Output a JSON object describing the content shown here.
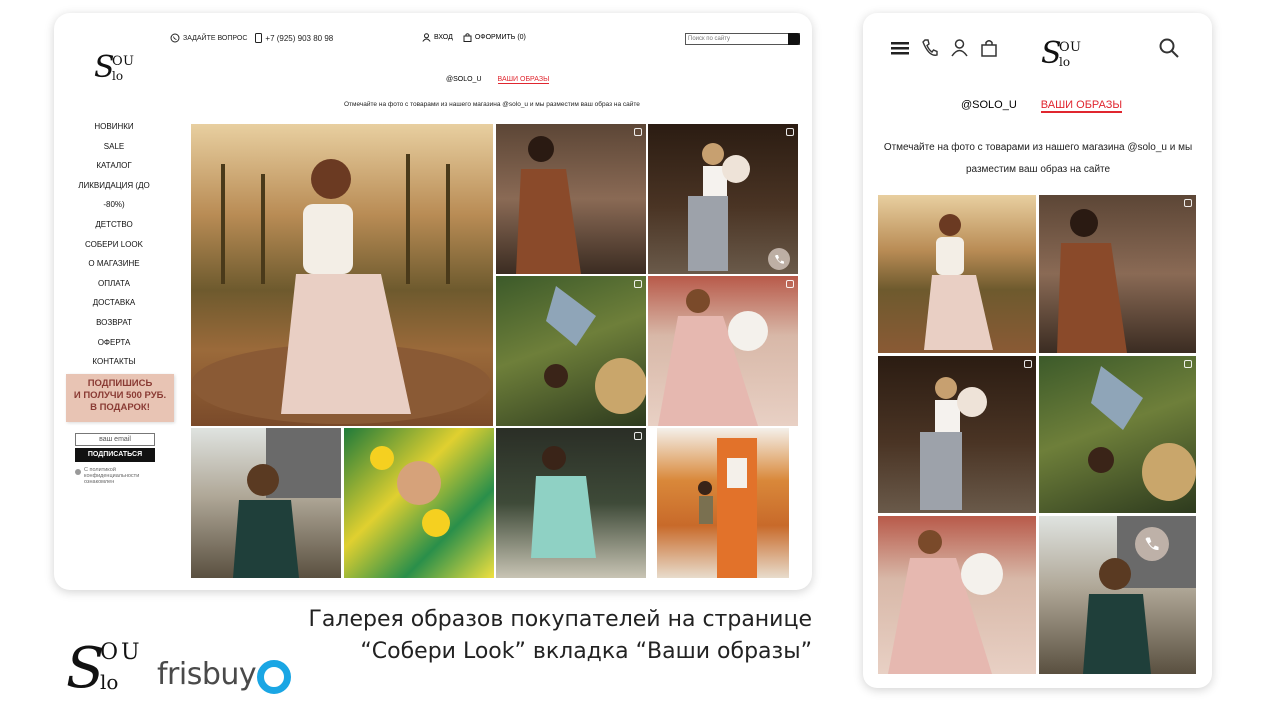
{
  "desktop": {
    "topbar": {
      "question": "ЗАДАЙТЕ ВОПРОС",
      "phone": "+7 (925) 903 80 98",
      "login": "ВХОД",
      "checkout": "ОФОРМИТЬ (0)",
      "search_placeholder": "Поиск по сайту"
    },
    "tabs": [
      "@SOLO_U",
      "ВАШИ ОБРАЗЫ"
    ],
    "caption": "Отмечайте на фото с товарами из нашего магазина @solo_u и мы разместим ваш образ на сайте",
    "menu": [
      "НОВИНКИ",
      "SALE",
      "КАТАЛОГ",
      "ЛИКВИДАЦИЯ (ДО",
      "-80%)",
      "ДЕТСТВО",
      "СОБЕРИ LOOK",
      "О МАГАЗИНЕ",
      "ОПЛАТА",
      "ДОСТАВКА",
      "ВОЗВРАТ",
      "ОФЕРТА",
      "КОНТАКТЫ"
    ],
    "promo": [
      "ПОДПИШИСЬ",
      "И ПОЛУЧИ 500 руб.",
      "В ПОДАРОК!"
    ],
    "email_placeholder": "ваш email",
    "subscribe": "ПОДПИСАТЬСЯ",
    "consent": "С политикой конфиденциальности ознакомлен"
  },
  "mobile": {
    "tabs": [
      "@SOLO_U",
      "ВАШИ ОБРАЗЫ"
    ],
    "caption_lines": [
      "Отмечайте на фото с товарами из нашего магазина @solo_u и мы",
      "разместим ваш образ на сайте"
    ]
  },
  "footer": {
    "title_lines": [
      "Галерея образов покупателей на странице",
      "“Собери Look” вкладка “Ваши образы”"
    ],
    "brand": "frisbuy"
  },
  "icons": [
    "whatsapp-icon",
    "phone-icon",
    "user-icon",
    "bag-icon",
    "search-icon",
    "menu-icon",
    "call-button-icon"
  ],
  "colors": {
    "accent": "#e0262f",
    "promo_bg": "#e8c4b4",
    "frisbuy_blue": "#1aa6e4"
  }
}
